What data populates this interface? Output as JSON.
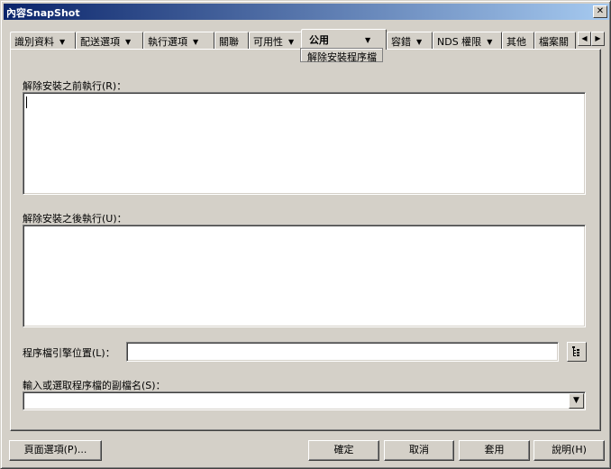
{
  "window": {
    "title": "內容SnapShot",
    "close_glyph": "✕"
  },
  "tabs": [
    {
      "label": "識別資料",
      "has_dropdown": true
    },
    {
      "label": "配送選項",
      "has_dropdown": true
    },
    {
      "label": "執行選項",
      "has_dropdown": true
    },
    {
      "label": "關聯",
      "has_dropdown": false
    },
    {
      "label": "可用性",
      "has_dropdown": true
    },
    {
      "label": "公用",
      "has_dropdown": true,
      "active": true
    },
    {
      "label": "容錯",
      "has_dropdown": true
    },
    {
      "label": "NDS 權限",
      "has_dropdown": true
    },
    {
      "label": "其他",
      "has_dropdown": false
    },
    {
      "label": "檔案關",
      "has_dropdown": false
    }
  ],
  "tab_scroll": {
    "left_glyph": "◀",
    "right_glyph": "▶"
  },
  "active_subtab": "解除安裝程序檔",
  "form": {
    "before_label": "解除安裝之前執行(R)：",
    "before_value": "",
    "after_label": "解除安裝之後執行(U)：",
    "after_value": "",
    "script_engine_label": "程序檔引擎位置(L)：",
    "script_engine_value": "",
    "extension_label": "輸入或選取程序檔的副檔名(S)：",
    "extension_value": "",
    "combo_arrow": "▼"
  },
  "buttons": {
    "page_options": "頁面選項(P)...",
    "ok": "確定",
    "cancel": "取消",
    "apply": "套用",
    "help": "說明(H)"
  },
  "colors": {
    "face": "#d4d0c8",
    "title_start": "#0a246a",
    "title_end": "#a6caf0"
  }
}
